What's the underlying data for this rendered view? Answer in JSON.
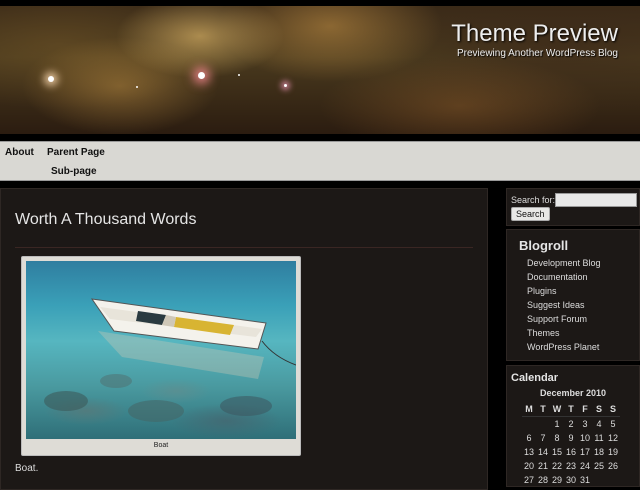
{
  "header": {
    "title": "Theme Preview",
    "description": "Previewing Another WordPress Blog"
  },
  "nav": {
    "items": [
      {
        "label": "About"
      },
      {
        "label": "Parent Page"
      },
      {
        "label": "Sub-page"
      }
    ]
  },
  "post": {
    "title": "Worth A Thousand Words",
    "image_caption": "Boat",
    "text": "Boat."
  },
  "search": {
    "label": "Search for:",
    "value": "",
    "button": "Search"
  },
  "blogroll": {
    "title": "Blogroll",
    "links": [
      "Development Blog",
      "Documentation",
      "Plugins",
      "Suggest Ideas",
      "Support Forum",
      "Themes",
      "WordPress Planet"
    ]
  },
  "calendar": {
    "title": "Calendar",
    "caption": "December 2010",
    "days": [
      "M",
      "T",
      "W",
      "T",
      "F",
      "S",
      "S"
    ],
    "weeks": [
      [
        "",
        "",
        "1",
        "2",
        "3",
        "4",
        "5"
      ],
      [
        "6",
        "7",
        "8",
        "9",
        "10",
        "11",
        "12"
      ],
      [
        "13",
        "14",
        "15",
        "16",
        "17",
        "18",
        "19"
      ],
      [
        "20",
        "21",
        "22",
        "23",
        "24",
        "25",
        "26"
      ],
      [
        "27",
        "28",
        "29",
        "30",
        "31",
        "",
        ""
      ]
    ]
  },
  "colors": {
    "page_background": "#000000",
    "content_background": "#1c1816",
    "nav_background": "#d9d8d3"
  }
}
